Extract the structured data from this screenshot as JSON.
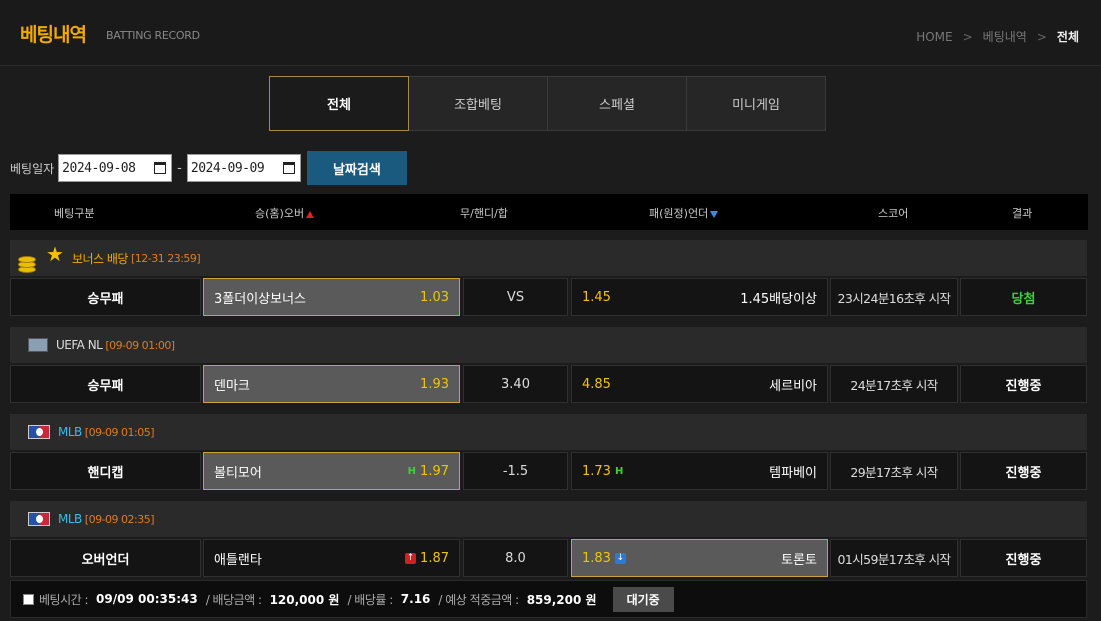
{
  "header": {
    "title": "베팅내역",
    "subtitle": "BATTING RECORD",
    "breadcrumb": [
      "HOME",
      "베팅내역",
      "전체"
    ]
  },
  "tabs": [
    "전체",
    "조합베팅",
    "스페셜",
    "미니게임"
  ],
  "datebar": {
    "label": "베팅일자",
    "from": "2024-09-08",
    "to": "2024-09-09",
    "button": "날짜검색"
  },
  "columns": [
    "베팅구분",
    "승(홈)오버",
    "무/핸디/합",
    "패(원정)언더",
    "스코어",
    "결과"
  ],
  "groups": [
    {
      "league": "보너스 배당",
      "date": "[12-31 23:59]",
      "league_color": "#f2a900",
      "type": "승무패",
      "home": "3폴더이상보너스",
      "home_odds": "1.03",
      "mid": "VS",
      "away_odds": "1.45",
      "away": "1.45배당이상",
      "score": "23시24분16초후 시작",
      "result": "당첨"
    },
    {
      "league": "UEFA NL",
      "date": "[09-09 01:00]",
      "league_color": "#dddddd",
      "type": "승무패",
      "home": "덴마크",
      "home_odds": "1.93",
      "mid": "3.40",
      "away_odds": "4.85",
      "away": "세르비아",
      "score": "24분17초후 시작",
      "result": "진행중"
    },
    {
      "league": "MLB",
      "date": "[09-09 01:05]",
      "league_color": "#33bde8",
      "type": "핸디캡",
      "home": "볼티모어",
      "home_mark": "H",
      "home_odds": "1.97",
      "mid": "-1.5",
      "away_odds": "1.73",
      "away_mark": "H",
      "away": "템파베이",
      "score": "29분17초후 시작",
      "result": "진행중"
    },
    {
      "league": "MLB",
      "date": "[09-09 02:35]",
      "league_color": "#33bde8",
      "type": "오버언더",
      "home": "애틀랜타",
      "home_odds": "1.87",
      "mid": "8.0",
      "away_odds": "1.83",
      "away": "토론토",
      "score": "01시59분17초후 시작",
      "result": "진행중"
    }
  ],
  "footer": {
    "time_label": "베팅시간 :",
    "time": "09/09 00:35:43",
    "amount_label": "/ 배당금액 :",
    "amount": "120,000 원",
    "rate_label": "/ 배당률 :",
    "rate": "7.16",
    "expected_label": "/ 예상 적중금액 :",
    "expected": "859,200 원",
    "status": "대기중"
  },
  "colors": {
    "accent": "#f2a900",
    "selected_border": "#c9a23a",
    "win": "#3ecf3e",
    "search_button": "#1a5a7e"
  }
}
